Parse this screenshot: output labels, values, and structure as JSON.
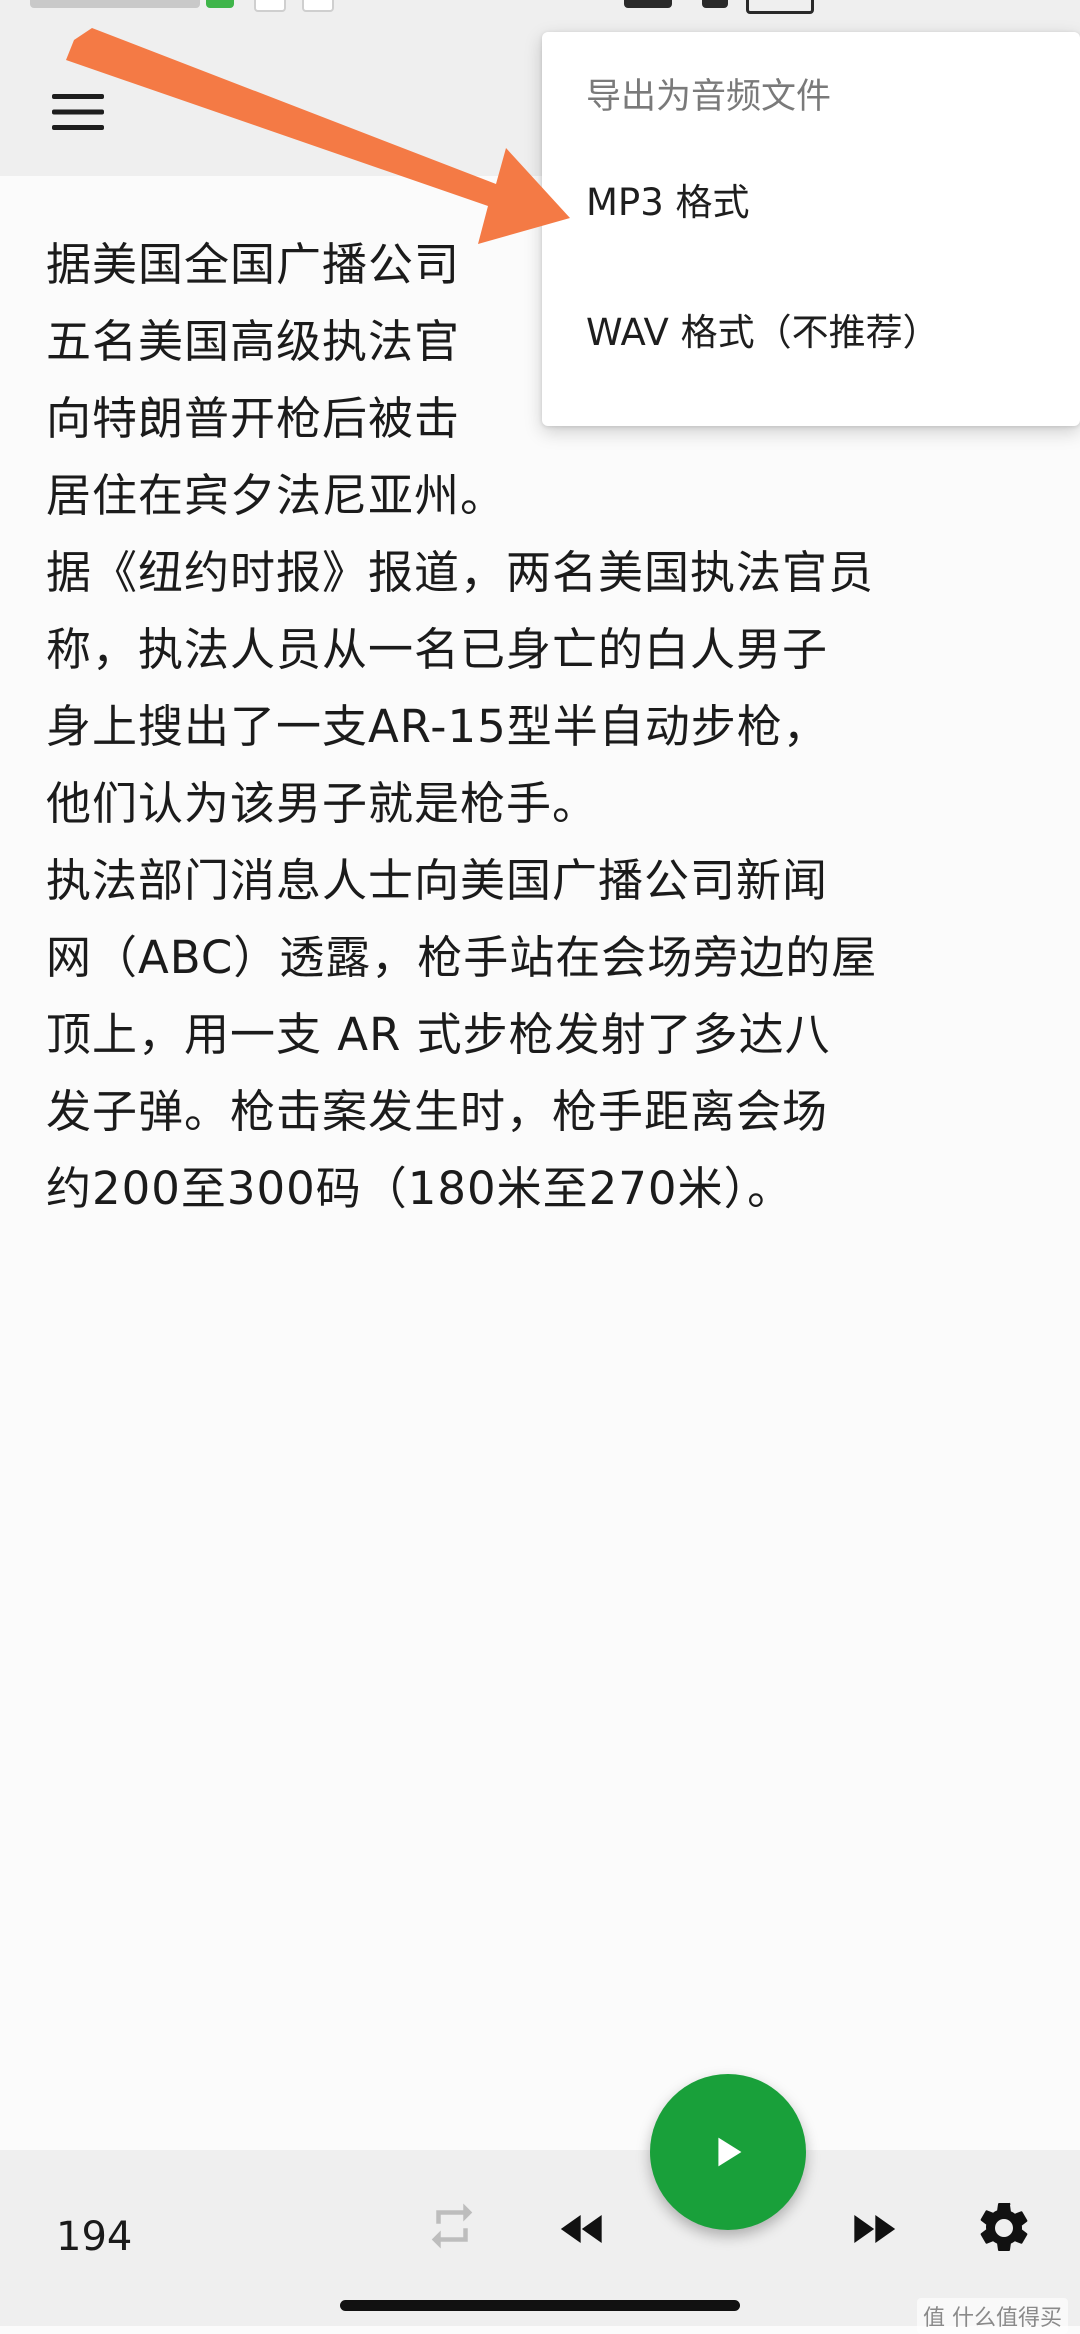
{
  "status_bar": {
    "colors": {
      "green_fragment": "#3fb54a",
      "dark_fragment": "#2a2a2a"
    }
  },
  "app_bar": {
    "menu_icon": "hamburger-menu-icon"
  },
  "article": {
    "text": "据美国全国广播公司\n五名美国高级执法官\n向特朗普开枪后被击\n居住在宾夕法尼亚州。\n据《纽约时报》报道，两名美国执法官员\n称，执法人员从一名已身亡的白人男子\n身上搜出了一支AR-15型半自动步枪，\n他们认为该男子就是枪手。\n执法部门消息人士向美国广播公司新闻\n网（ABC）透露，枪手站在会场旁边的屋\n顶上，用一支 AR 式步枪发射了多达八\n发子弹。枪击案发生时，枪手距离会场\n约200至300码（180米至270米）。"
  },
  "dropdown": {
    "header": "导出为音频文件",
    "items": [
      {
        "label": "MP3 格式"
      },
      {
        "label": "WAV 格式（不推荐）"
      }
    ]
  },
  "annotation": {
    "arrow_color": "#f47a45"
  },
  "bottom_bar": {
    "page_count": "194",
    "icons": {
      "repeat": "repeat-icon",
      "rewind": "rewind-icon",
      "play": "play-icon",
      "fast_forward": "fast-forward-icon",
      "settings": "gear-icon"
    },
    "colors": {
      "play_button": "#19a03a",
      "repeat_disabled": "#bdbdbd"
    }
  },
  "watermark": {
    "text": "值 什么值得买"
  }
}
